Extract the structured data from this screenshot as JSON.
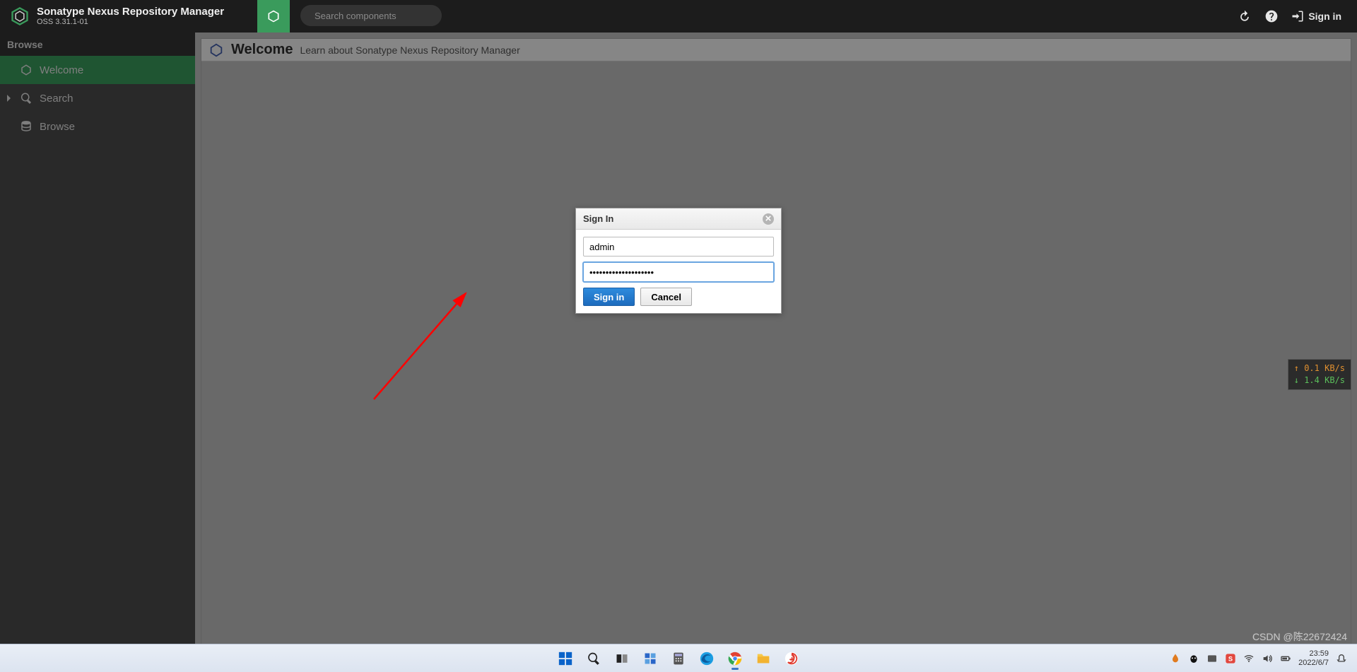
{
  "header": {
    "app_title": "Sonatype Nexus Repository Manager",
    "app_version": "OSS 3.31.1-01",
    "search_placeholder": "Search components",
    "signin_label": "Sign in"
  },
  "sidebar": {
    "heading": "Browse",
    "items": [
      {
        "id": "welcome",
        "label": "Welcome"
      },
      {
        "id": "search",
        "label": "Search"
      },
      {
        "id": "browse",
        "label": "Browse"
      }
    ]
  },
  "page": {
    "title": "Welcome",
    "subtitle": "Learn about Sonatype Nexus Repository Manager"
  },
  "dialog": {
    "title": "Sign In",
    "username_value": "admin",
    "password_value": "••••••••••••••••••••",
    "signin_btn": "Sign in",
    "cancel_btn": "Cancel"
  },
  "net_overlay": {
    "up": "↑ 0.1 KB/s",
    "down": "↓ 1.4 KB/s"
  },
  "watermark": "CSDN @陈22672424",
  "taskbar": {
    "clock_time": "23:59",
    "clock_date": "2022/6/7"
  }
}
